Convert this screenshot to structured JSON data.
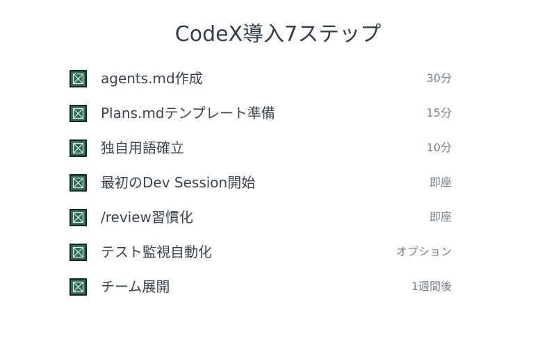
{
  "title": "CodeX導入7ステップ",
  "icons": {
    "check": "checked-box-icon"
  },
  "colors": {
    "check_fill": "#2e6e52",
    "check_border": "#16241d",
    "text": "#3a4450",
    "muted": "#7a828a"
  },
  "steps": [
    {
      "label": "agents.md作成",
      "time": "30分",
      "checked": true
    },
    {
      "label": "Plans.mdテンプレート準備",
      "time": "15分",
      "checked": true
    },
    {
      "label": "独自用語確立",
      "time": "10分",
      "checked": true
    },
    {
      "label": "最初のDev Session開始",
      "time": "即座",
      "checked": true
    },
    {
      "label": "/review習慣化",
      "time": "即座",
      "checked": true
    },
    {
      "label": "テスト監視自動化",
      "time": "オプション",
      "checked": true
    },
    {
      "label": "チーム展開",
      "time": "1週間後",
      "checked": true
    }
  ]
}
